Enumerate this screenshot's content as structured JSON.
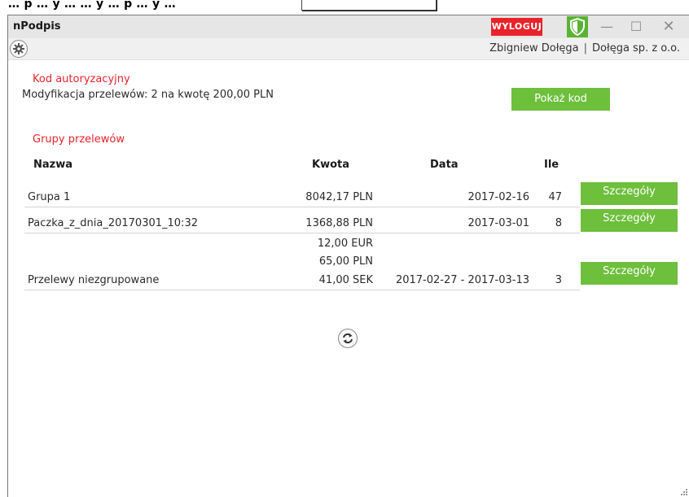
{
  "window": {
    "app_title": "nPodpis",
    "logout_label": "WYLOGUJ",
    "minimize_glyph": "—",
    "maximize_glyph": "☐",
    "close_glyph": "✕"
  },
  "user": {
    "name": "Zbigniew Dołęga",
    "separator": "|",
    "company": "Dołęga sp. z o.o."
  },
  "auth": {
    "title": "Kod autoryzacyjny",
    "description": "Modyfikacja przelewów: 2 na kwotę 200,00 PLN",
    "show_code_label": "Pokaż kod"
  },
  "groups": {
    "title": "Grupy przelewów",
    "columns": [
      "Nazwa",
      "Kwota",
      "Data",
      "Ile"
    ],
    "rows": [
      {
        "name": "Grupa 1",
        "amounts": [
          "8042,17 PLN"
        ],
        "date": "2017-02-16",
        "count": "47",
        "details_label": "Szczegóły"
      },
      {
        "name": "Paczka_z_dnia_20170301_10:32",
        "amounts": [
          "1368,88 PLN"
        ],
        "date": "2017-03-01",
        "count": "8",
        "details_label": "Szczegóły"
      },
      {
        "name": "Przelewy niezgrupowane",
        "amounts": [
          "12,00 EUR",
          "65,00 PLN",
          "41,00 SEK"
        ],
        "date": "2017-02-27 - 2017-03-13",
        "count": "3",
        "details_label": "Szczegóły"
      }
    ]
  },
  "colors": {
    "accent_red": "#e8232a",
    "accent_green": "#6ebf3c",
    "shield_green": "#5ab334"
  },
  "icons": {
    "settings": "gear-icon",
    "security": "shield-icon",
    "refresh": "refresh-icon"
  }
}
